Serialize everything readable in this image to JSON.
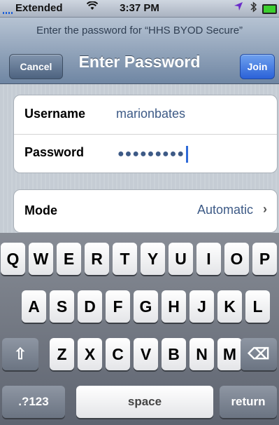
{
  "status_bar": {
    "carrier": "Extended",
    "time": "3:37 PM"
  },
  "nav": {
    "prompt": "Enter the password for “HHS BYOD Secure”",
    "title": "Enter Password",
    "cancel_label": "Cancel",
    "join_label": "Join"
  },
  "form": {
    "username_label": "Username",
    "username_value": "marionbates",
    "password_label": "Password",
    "password_masked": "●●●●●●●●●",
    "mode_label": "Mode",
    "mode_value": "Automatic",
    "mode_chevron": "›"
  },
  "keyboard": {
    "row1": [
      "Q",
      "W",
      "E",
      "R",
      "T",
      "Y",
      "U",
      "I",
      "O",
      "P"
    ],
    "row2": [
      "A",
      "S",
      "D",
      "F",
      "G",
      "H",
      "J",
      "K",
      "L"
    ],
    "row3": [
      "Z",
      "X",
      "C",
      "V",
      "B",
      "N",
      "M"
    ],
    "shift_glyph": "⇧",
    "delete_glyph": "⌫",
    "numbers_label": ".?123",
    "space_label": "space",
    "return_label": "return"
  },
  "icons": {
    "wifi": "wifi-icon",
    "location": "location-arrow-icon",
    "bluetooth": "bluetooth-icon",
    "battery": "battery-icon"
  },
  "colors": {
    "accent_blue": "#2b62d8",
    "value_text": "#3d5a86",
    "battery_green": "#3ccf2f"
  }
}
